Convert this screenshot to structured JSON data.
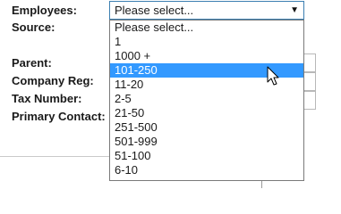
{
  "form": {
    "labels": {
      "employees": "Employees:",
      "source": "Source:",
      "parent": "Parent:",
      "company_reg": "Company Reg:",
      "tax_number": "Tax Number:",
      "primary_contact": "Primary Contact:"
    },
    "employees_select": {
      "selected": "Please select...",
      "arrow": "▼",
      "options": [
        "Please select...",
        "1",
        "1000 +",
        "101-250",
        "11-20",
        "2-5",
        "21-50",
        "251-500",
        "501-999",
        "51-100",
        "6-10"
      ],
      "highlighted_option": "101-250"
    }
  },
  "colors": {
    "highlight": "#3399ff",
    "select_border": "#3c7fb1"
  },
  "icons": {
    "cursor": "arrow-cursor-icon",
    "dropdown_arrow": "triangle-down-icon"
  }
}
